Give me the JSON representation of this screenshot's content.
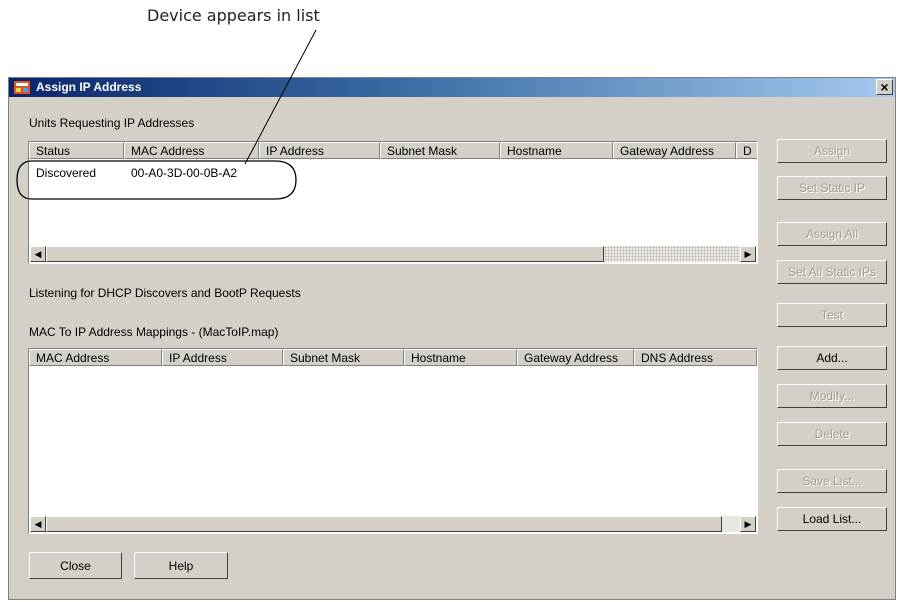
{
  "annotation": {
    "text": "Device appears in list"
  },
  "window": {
    "title": "Assign IP Address",
    "close_glyph": "×"
  },
  "requests": {
    "label": "Units Requesting IP Addresses",
    "columns": [
      "Status",
      "MAC Address",
      "IP Address",
      "Subnet Mask",
      "Hostname",
      "Gateway Address",
      "D"
    ],
    "rows": [
      {
        "status": "Discovered",
        "mac": "00-A0-3D-00-0B-A2",
        "ip": "",
        "subnet": "",
        "hostname": "",
        "gateway": ""
      }
    ],
    "status_text": "Listening for DHCP Discovers and BootP Requests"
  },
  "mappings": {
    "label": "MAC To IP Address Mappings - (MacToIP.map)",
    "columns": [
      "MAC Address",
      "IP Address",
      "Subnet Mask",
      "Hostname",
      "Gateway Address",
      "DNS Address"
    ],
    "rows": []
  },
  "side_buttons": {
    "assign": "Assign",
    "set_static_ip": "Set Static IP",
    "assign_all": "Assign All",
    "set_all_static_ips": "Set All Static IPs",
    "test": "Test",
    "add": "Add...",
    "modify": "Modify...",
    "delete": "Delete",
    "save_list": "Save List...",
    "load_list": "Load List..."
  },
  "bottom_buttons": {
    "close": "Close",
    "help": "Help"
  },
  "icons": {
    "scroll_left": "◀",
    "scroll_right": "▶"
  },
  "colors": {
    "titlebar_start": "#0a246a",
    "titlebar_end": "#a6caf0",
    "dialog_bg": "#d4d0c8"
  }
}
